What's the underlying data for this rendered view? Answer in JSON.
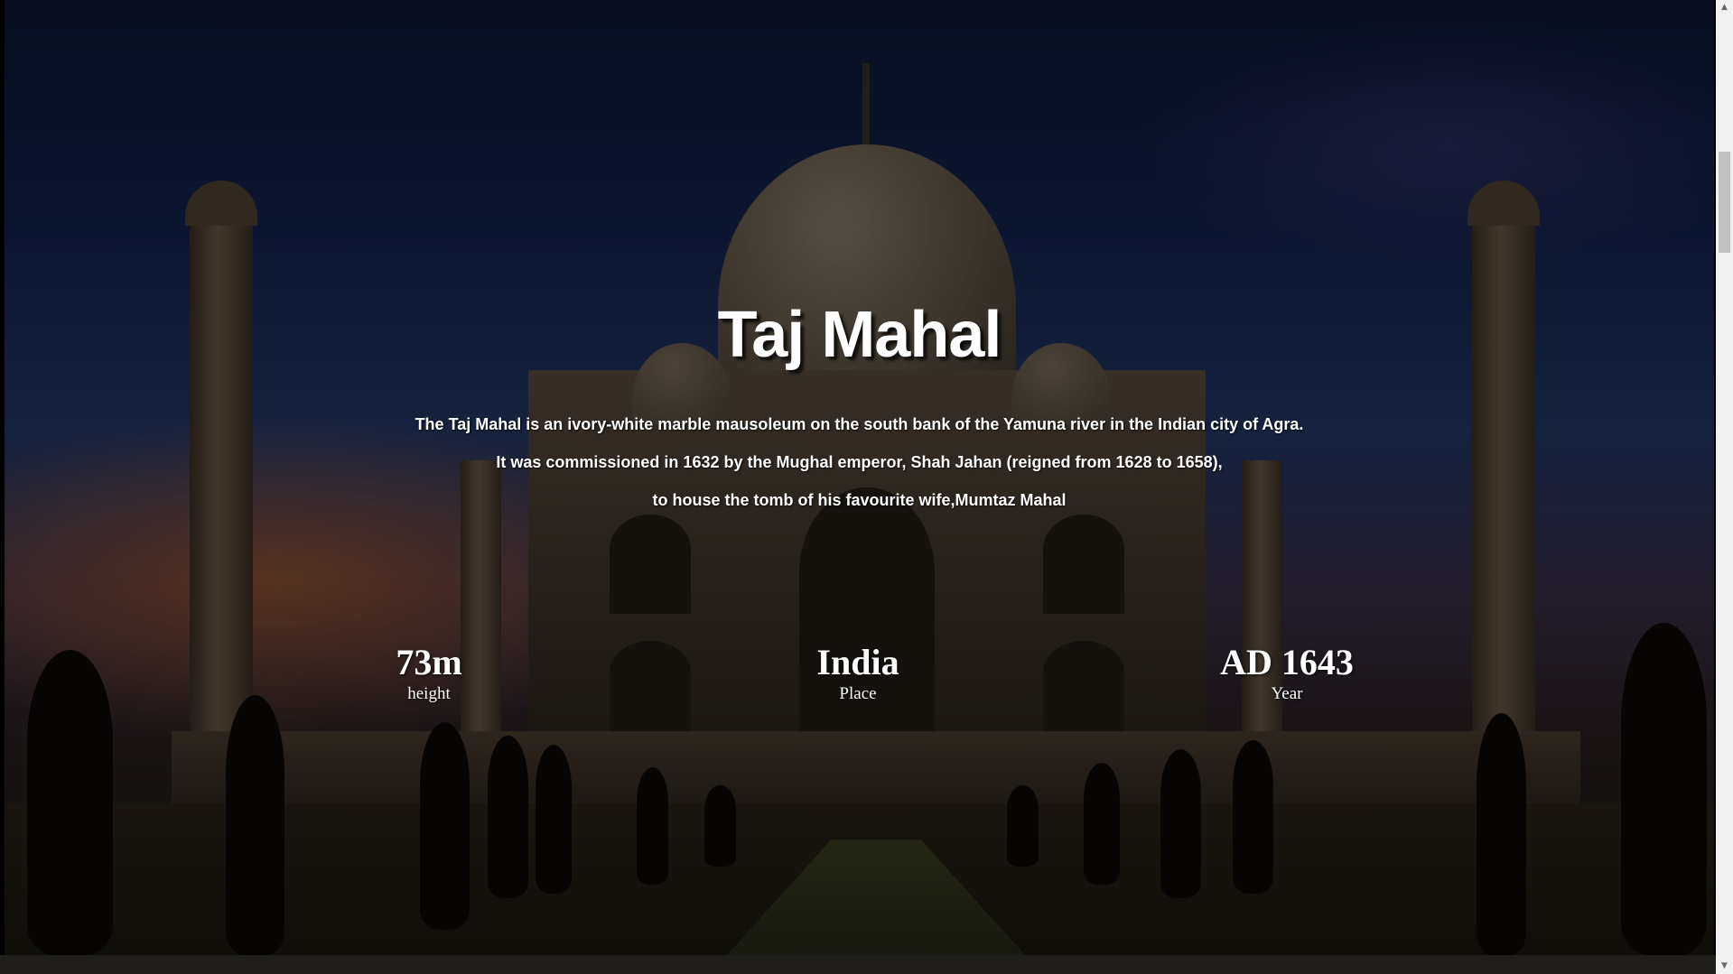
{
  "hero": {
    "title": "Taj Mahal",
    "description_lines": [
      "The Taj Mahal is an ivory-white marble mausoleum on the south bank of the Yamuna river in the Indian city of Agra.",
      "It was commissioned in 1632 by the Mughal emperor, Shah Jahan (reigned from 1628 to 1658),",
      "to house the tomb of his favourite wife,Mumtaz Mahal"
    ]
  },
  "stats": [
    {
      "value": "73m",
      "label": "height"
    },
    {
      "value": "India",
      "label": "Place"
    },
    {
      "value": "AD 1643",
      "label": "Year"
    }
  ],
  "scrollbar": {
    "up_icon": "arrow-up-icon",
    "down_icon": "arrow-down-icon"
  }
}
